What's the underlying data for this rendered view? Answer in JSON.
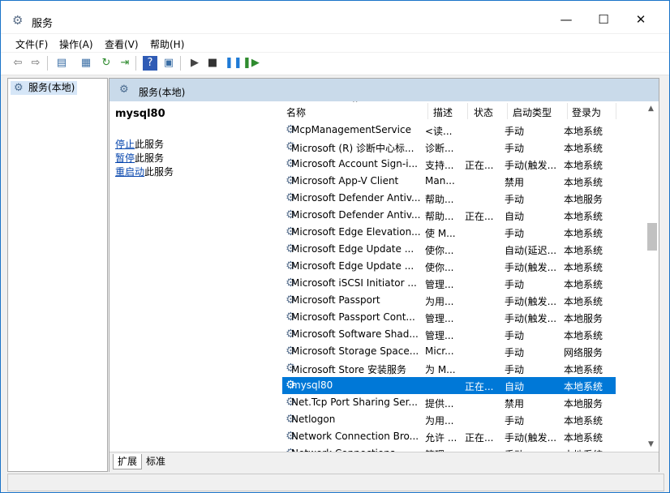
{
  "window": {
    "title": "服务",
    "minimize": "—",
    "maximize": "☐",
    "close": "✕"
  },
  "menu": [
    "文件(F)",
    "操作(A)",
    "查看(V)",
    "帮助(H)"
  ],
  "toolbar": [
    {
      "name": "back-icon",
      "glyph": "⇦",
      "color": "#6b6b6b"
    },
    {
      "name": "forward-icon",
      "glyph": "⇨",
      "color": "#6b6b6b"
    },
    {
      "name": "show-hide-tree-icon",
      "glyph": "▤",
      "color": "#3a6ea5"
    },
    {
      "name": "properties-icon",
      "glyph": "▦",
      "color": "#3a6ea5"
    },
    {
      "name": "refresh-icon",
      "glyph": "↻",
      "color": "#2e8b2e"
    },
    {
      "name": "export-list-icon",
      "glyph": "⇥",
      "color": "#2e8b2e"
    },
    {
      "name": "help-icon",
      "glyph": "?",
      "color": "#ffffff",
      "bg": "#2f5bb5"
    },
    {
      "name": "console-icon",
      "glyph": "▣",
      "color": "#3a6ea5"
    },
    {
      "name": "start-service-icon",
      "glyph": "▶",
      "color": "#444444"
    },
    {
      "name": "stop-service-icon",
      "glyph": "■",
      "color": "#333333"
    },
    {
      "name": "pause-service-icon",
      "glyph": "❚❚",
      "color": "#1e7ad6"
    },
    {
      "name": "resume-service-icon",
      "glyph": "❚▶",
      "color": "#2e8b2e"
    }
  ],
  "tree": {
    "label": "服务(本地)"
  },
  "main": {
    "header": "服务(本地)"
  },
  "detail": {
    "service_name": "mysql80",
    "stop_link": "停止",
    "stop_suffix": "此服务",
    "pause_link": "暂停",
    "pause_suffix": "此服务",
    "restart_link": "重启动",
    "restart_suffix": "此服务"
  },
  "columns": {
    "name": "名称",
    "desc": "描述",
    "status": "状态",
    "startup": "启动类型",
    "logon": "登录为"
  },
  "rows": [
    {
      "name": "McpManagementService",
      "desc": "<读...",
      "status": "",
      "startup": "手动",
      "logon": "本地系统"
    },
    {
      "name": "Microsoft (R) 诊断中心标...",
      "desc": "诊断...",
      "status": "",
      "startup": "手动",
      "logon": "本地系统"
    },
    {
      "name": "Microsoft Account Sign-i...",
      "desc": "支持...",
      "status": "正在...",
      "startup": "手动(触发...",
      "logon": "本地系统"
    },
    {
      "name": "Microsoft App-V Client",
      "desc": "Man...",
      "status": "",
      "startup": "禁用",
      "logon": "本地系统"
    },
    {
      "name": "Microsoft Defender Antiv...",
      "desc": "帮助...",
      "status": "",
      "startup": "手动",
      "logon": "本地服务"
    },
    {
      "name": "Microsoft Defender Antiv...",
      "desc": "帮助...",
      "status": "正在...",
      "startup": "自动",
      "logon": "本地系统"
    },
    {
      "name": "Microsoft Edge Elevation...",
      "desc": "使 M...",
      "status": "",
      "startup": "手动",
      "logon": "本地系统"
    },
    {
      "name": "Microsoft Edge Update ...",
      "desc": "使你...",
      "status": "",
      "startup": "自动(延迟...",
      "logon": "本地系统"
    },
    {
      "name": "Microsoft Edge Update ...",
      "desc": "使你...",
      "status": "",
      "startup": "手动(触发...",
      "logon": "本地系统"
    },
    {
      "name": "Microsoft iSCSI Initiator ...",
      "desc": "管理...",
      "status": "",
      "startup": "手动",
      "logon": "本地系统"
    },
    {
      "name": "Microsoft Passport",
      "desc": "为用...",
      "status": "",
      "startup": "手动(触发...",
      "logon": "本地系统"
    },
    {
      "name": "Microsoft Passport Cont...",
      "desc": "管理...",
      "status": "",
      "startup": "手动(触发...",
      "logon": "本地服务"
    },
    {
      "name": "Microsoft Software Shad...",
      "desc": "管理...",
      "status": "",
      "startup": "手动",
      "logon": "本地系统"
    },
    {
      "name": "Microsoft Storage Space...",
      "desc": "Micr...",
      "status": "",
      "startup": "手动",
      "logon": "网络服务"
    },
    {
      "name": "Microsoft Store 安装服务",
      "desc": "为 M...",
      "status": "",
      "startup": "手动",
      "logon": "本地系统"
    },
    {
      "name": "mysql80",
      "desc": "",
      "status": "正在...",
      "startup": "自动",
      "logon": "本地系统",
      "selected": true
    },
    {
      "name": "Net.Tcp Port Sharing Ser...",
      "desc": "提供...",
      "status": "",
      "startup": "禁用",
      "logon": "本地服务"
    },
    {
      "name": "Netlogon",
      "desc": "为用...",
      "status": "",
      "startup": "手动",
      "logon": "本地系统"
    },
    {
      "name": "Network Connection Bro...",
      "desc": "允许 ...",
      "status": "正在...",
      "startup": "手动(触发...",
      "logon": "本地系统"
    },
    {
      "name": "Network Connections",
      "desc": "管理...",
      "status": "",
      "startup": "手动",
      "logon": "本地系统"
    }
  ],
  "tabs": [
    "扩展",
    "标准"
  ]
}
